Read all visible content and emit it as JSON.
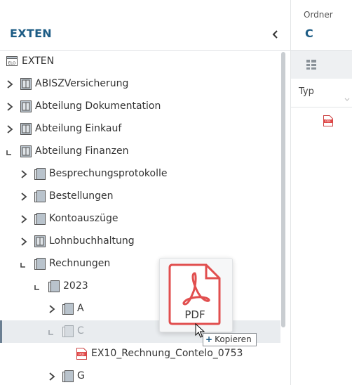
{
  "repository": {
    "title": "EXTEN"
  },
  "tree": {
    "root": "EXTEN",
    "items": [
      {
        "label": "ABISZVersicherung"
      },
      {
        "label": "Abteilung Dokumentation"
      },
      {
        "label": "Abteilung Einkauf"
      },
      {
        "label": "Abteilung Finanzen"
      },
      {
        "label": "Besprechungsprotokolle"
      },
      {
        "label": "Bestellungen"
      },
      {
        "label": "Kontoauszüge"
      },
      {
        "label": "Lohnbuchhaltung"
      },
      {
        "label": "Rechnungen"
      },
      {
        "label": "2023"
      },
      {
        "label": "A"
      },
      {
        "label": "C"
      },
      {
        "label": "EX10_Rechnung_Contelo_0753"
      },
      {
        "label": "G"
      }
    ]
  },
  "right_panel": {
    "label": "Ordner",
    "title": "C",
    "column_header": "Typ"
  },
  "drag": {
    "file_type": "PDF",
    "tooltip": "Kopieren",
    "tooltip_symbol": "+"
  },
  "colors": {
    "accent": "#1d5c85",
    "pdf_red": "#e04848",
    "selection": "#e9ecef"
  }
}
